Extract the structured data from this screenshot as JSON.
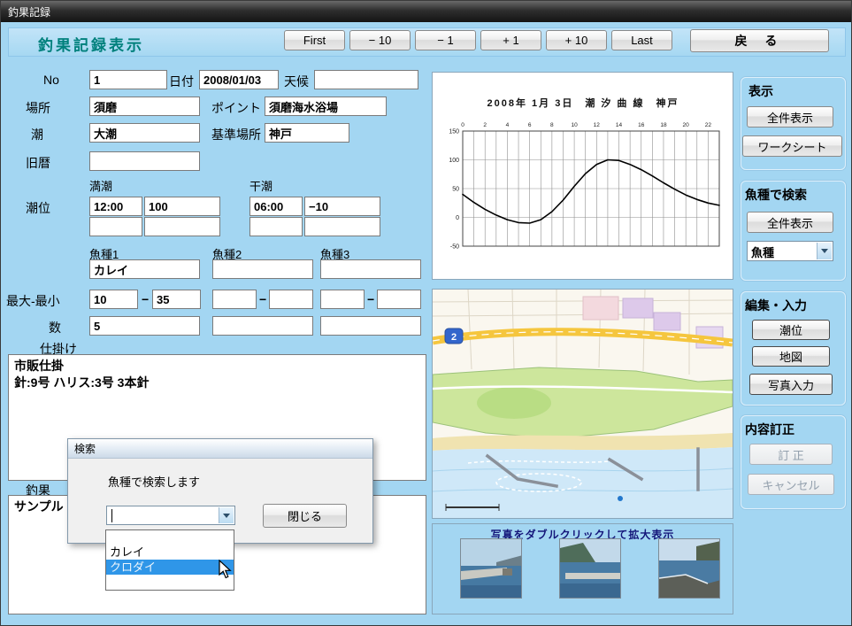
{
  "window": {
    "title": "釣果記録"
  },
  "header": {
    "title": "釣果記録表示",
    "nav": [
      "First",
      "−  10",
      "−  1",
      "+  1",
      "+  10",
      "Last"
    ],
    "back": "戻 る"
  },
  "form": {
    "no_label": "No",
    "no": "1",
    "date_label": "日付",
    "date": "2008/01/03",
    "weather_label": "天候",
    "weather": "",
    "place_label": "場所",
    "place": "須磨",
    "point_label": "ポイント",
    "point": "須磨海水浴場",
    "tide_label": "潮",
    "tide": "大潮",
    "base_label": "基準場所",
    "base": "神戸",
    "old_label": "旧暦",
    "old": "",
    "high_label": "満潮",
    "low_label": "干潮",
    "level_label": "潮位",
    "high_time": "12:00",
    "high_level": "100",
    "low_time": "06:00",
    "low_level": "−10",
    "species_labels": [
      "魚種1",
      "魚種2",
      "魚種3"
    ],
    "species": [
      "カレイ",
      "",
      ""
    ],
    "minmax_label": "最大-最小",
    "min1": "10",
    "max1": "35",
    "dash": "−",
    "count_label": "数",
    "count": "5",
    "rig_label": "仕掛け",
    "rig_text": "市販仕掛\n針:9号 ハリス:3号 3本針",
    "result_label": "釣果",
    "result_text": "サンプル"
  },
  "dialog": {
    "title": "検索",
    "message": "魚種で検索します",
    "close": "閉じる",
    "options": [
      "",
      "カレイ",
      "クロダイ"
    ],
    "highlighted": "クロダイ"
  },
  "tide_chart": {
    "title": "2008年 1月 3日　潮 汐 曲 線　神戸",
    "ylim": [
      -50,
      150
    ],
    "y_ticks": [
      "150",
      "100",
      "50",
      "0",
      "-50"
    ],
    "x_ticks": [
      "0",
      "2",
      "4",
      "6",
      "8",
      "10",
      "12",
      "14",
      "16",
      "18",
      "20",
      "22"
    ],
    "points": [
      [
        0,
        40
      ],
      [
        1,
        26
      ],
      [
        2,
        14
      ],
      [
        3,
        4
      ],
      [
        4,
        -4
      ],
      [
        5,
        -9
      ],
      [
        6,
        -10
      ],
      [
        7,
        -4
      ],
      [
        8,
        10
      ],
      [
        9,
        30
      ],
      [
        10,
        54
      ],
      [
        11,
        76
      ],
      [
        12,
        92
      ],
      [
        13,
        100
      ],
      [
        14,
        99
      ],
      [
        15,
        92
      ],
      [
        16,
        83
      ],
      [
        17,
        72
      ],
      [
        18,
        60
      ],
      [
        19,
        49
      ],
      [
        20,
        39
      ],
      [
        21,
        31
      ],
      [
        22,
        25
      ],
      [
        23,
        21
      ]
    ]
  },
  "map": {
    "route_badge": "2"
  },
  "photos": {
    "caption": "写真をダブルクリックして拡大表示"
  },
  "sidebar": {
    "display_group": {
      "label": "表示",
      "buttons": [
        "全件表示",
        "ワークシート"
      ]
    },
    "search_group": {
      "label": "魚種で検索",
      "button": "全件表示",
      "combo": "魚種"
    },
    "edit_group": {
      "label": "編集・入力",
      "buttons": [
        "潮位",
        "地図",
        "写真入力"
      ]
    },
    "correct_group": {
      "label": "内容訂正",
      "buttons": [
        "訂 正",
        "キャンセル"
      ]
    }
  }
}
